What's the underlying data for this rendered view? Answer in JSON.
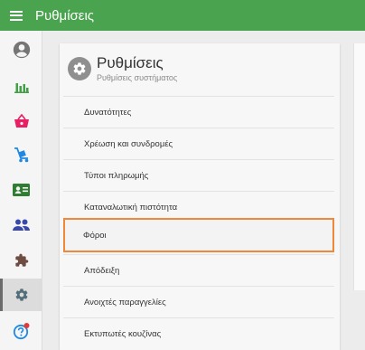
{
  "app": {
    "title": "Ρυθμίσεις"
  },
  "sidebar": {
    "items": [
      {
        "name": "account",
        "icon": "account-circle-icon",
        "color": "#757575",
        "active": false
      },
      {
        "name": "reports",
        "icon": "bar-chart-icon",
        "color": "#43a047",
        "active": false
      },
      {
        "name": "shop",
        "icon": "shopping-basket-icon",
        "color": "#e91e63",
        "active": false
      },
      {
        "name": "delivery",
        "icon": "cart-icon",
        "color": "#1e88e5",
        "active": false
      },
      {
        "name": "customers",
        "icon": "id-card-icon",
        "color": "#2e7d32",
        "active": false
      },
      {
        "name": "users",
        "icon": "people-icon",
        "color": "#3949ab",
        "active": false
      },
      {
        "name": "extensions",
        "icon": "puzzle-icon",
        "color": "#6d4c41",
        "active": false
      },
      {
        "name": "settings",
        "icon": "gear-icon",
        "color": "#546e7a",
        "active": true
      },
      {
        "name": "help",
        "icon": "help-icon",
        "color": "#1e88e5",
        "badge_color": "#e53935",
        "active": false
      }
    ]
  },
  "card": {
    "title": "Ρυθμίσεις",
    "subtitle": "Ρυθμίσεις συστήματος",
    "icon": "gear-icon"
  },
  "menu": {
    "items": [
      {
        "label": "Δυνατότητες",
        "highlighted": false
      },
      {
        "label": "Χρέωση και συνδρομές",
        "highlighted": false
      },
      {
        "label": "Τύποι πληρωμής",
        "highlighted": false
      },
      {
        "label": "Καταναλωτική πιστότητα",
        "highlighted": false
      },
      {
        "label": "Φόροι",
        "highlighted": true
      },
      {
        "label": "Απόδειξη",
        "highlighted": false
      },
      {
        "label": "Ανοιχτές παραγγελίες",
        "highlighted": false
      },
      {
        "label": "Εκτυπωτές κουζίνας",
        "highlighted": false
      }
    ]
  },
  "colors": {
    "topbar": "#4aa44f",
    "highlight_border": "#f0883a"
  }
}
